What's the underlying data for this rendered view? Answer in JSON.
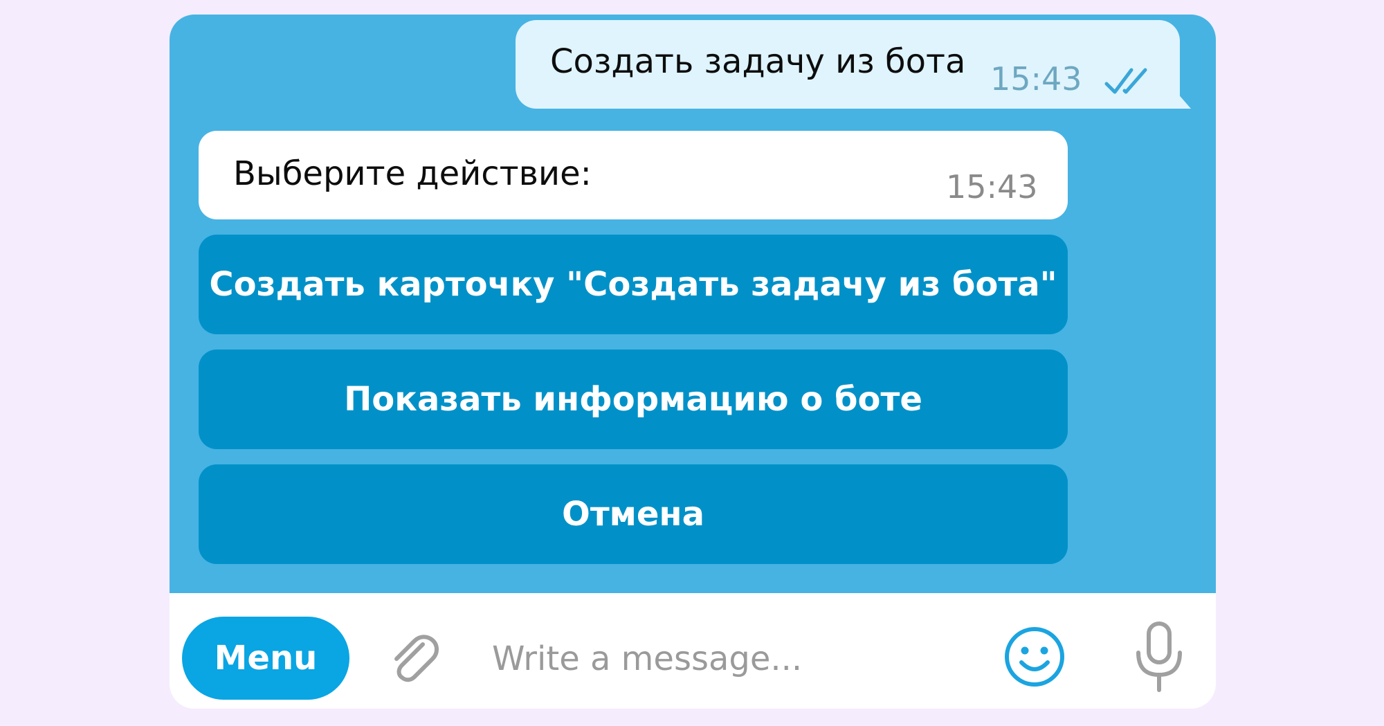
{
  "chat": {
    "outgoing": {
      "text": "Создать задачу из бота",
      "time": "15:43",
      "status_icon": "double-check-icon"
    },
    "incoming": {
      "text": "Выберите действие:",
      "time": "15:43"
    },
    "keyboard": [
      {
        "label": "Создать карточку \"Создать задачу из бота\""
      },
      {
        "label": "Показать информацию о боте"
      },
      {
        "label": "Отмена"
      }
    ]
  },
  "input_bar": {
    "menu_label": "Menu",
    "placeholder": "Write a message...",
    "icons": [
      "paperclip-icon",
      "smiley-icon",
      "microphone-icon"
    ]
  },
  "colors": {
    "page_background": "#f5ecfd",
    "chat_background": "#47b3e3",
    "outgoing_bubble": "#dff4fd",
    "incoming_bubble": "#ffffff",
    "keyboard_button": "#0191c8",
    "menu_button": "#0aa5e3",
    "accent_icon": "#1ba4e0",
    "muted_icon": "#a0a0a0"
  }
}
